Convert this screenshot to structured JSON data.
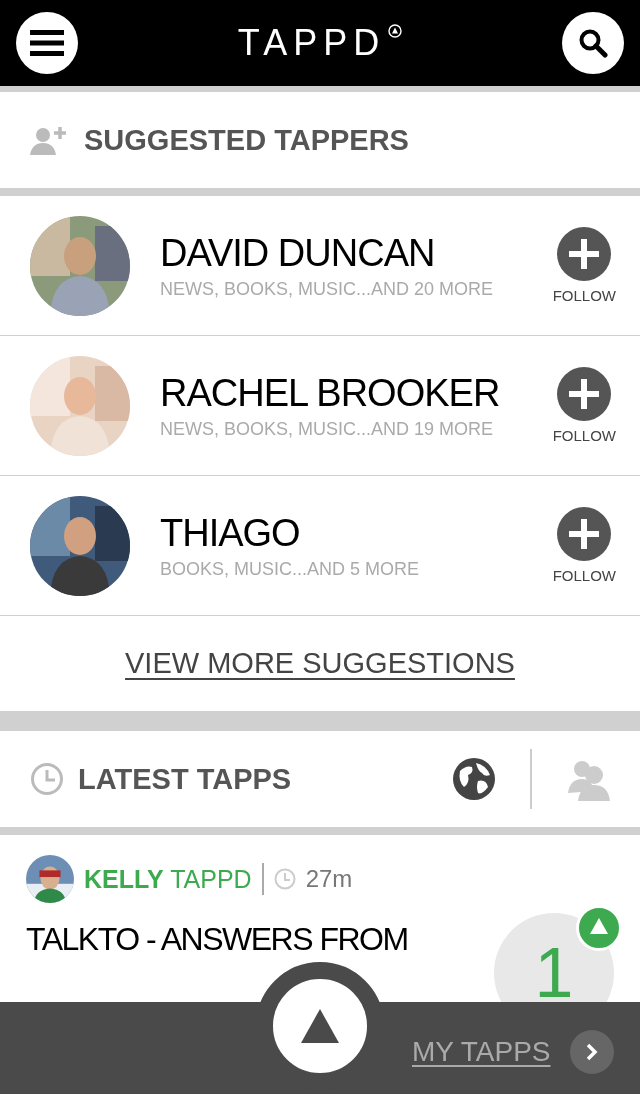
{
  "header": {
    "logo": "TAPPD"
  },
  "suggested": {
    "title": "SUGGESTED TAPPERS",
    "people": [
      {
        "name": "DAVID DUNCAN",
        "interests": "NEWS, BOOKS, MUSIC...AND 20 MORE",
        "follow": "FOLLOW"
      },
      {
        "name": "RACHEL BROOKER",
        "interests": "NEWS, BOOKS, MUSIC...AND 19 MORE",
        "follow": "FOLLOW"
      },
      {
        "name": "THIAGO",
        "interests": "BOOKS, MUSIC...AND 5 MORE",
        "follow": "FOLLOW"
      }
    ],
    "view_more": "VIEW MORE SUGGESTIONS"
  },
  "latest": {
    "title": "LATEST TAPPS",
    "filters": [
      {
        "kind": "globe",
        "selected": true
      },
      {
        "kind": "people",
        "selected": false
      }
    ]
  },
  "feed": [
    {
      "author_first": "KELLY",
      "author_last": "TAPPD",
      "time": "27m",
      "title": "TALKTO - ANSWERS FROM",
      "count": "1"
    }
  ],
  "bottom_bar": {
    "my_tapps": "MY TAPPS"
  }
}
